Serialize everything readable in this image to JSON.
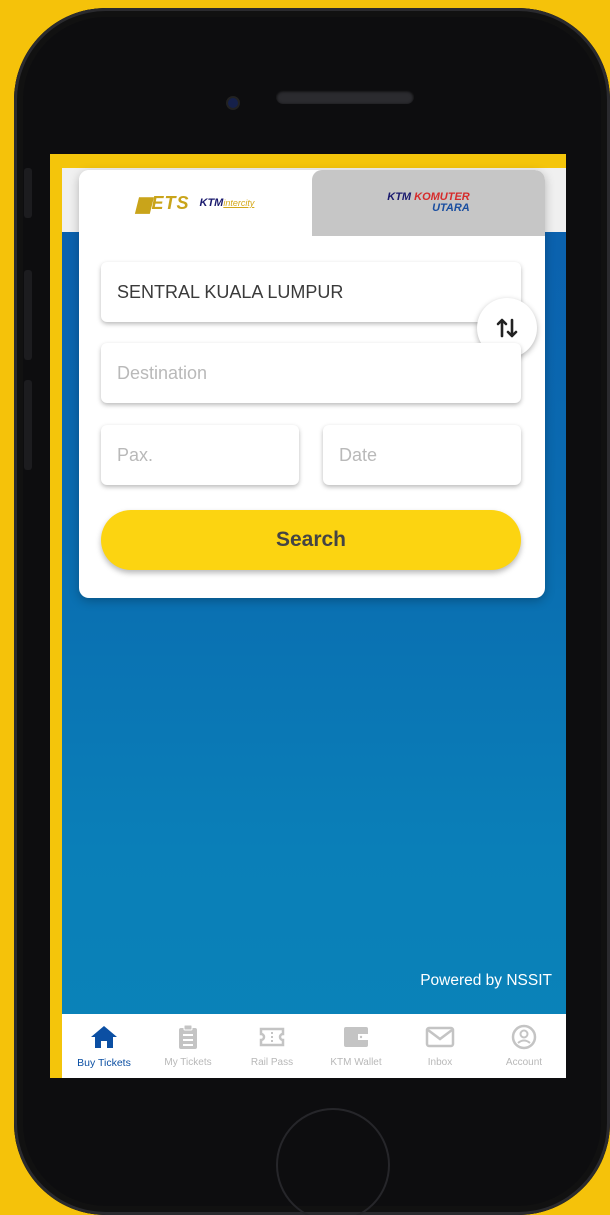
{
  "tabs": [
    {
      "ets_logo": "ETS",
      "ktm_logo": "KTM",
      "ktm_sub": "intercity",
      "active": true
    },
    {
      "komuter_line1a": "KTM ",
      "komuter_line1b": "KOMUTER",
      "komuter_line2": "UTARA",
      "active": false
    }
  ],
  "form": {
    "origin_value": "SENTRAL KUALA LUMPUR",
    "destination_placeholder": "Destination",
    "pax_placeholder": "Pax.",
    "date_placeholder": "Date",
    "search_label": "Search"
  },
  "footer": {
    "powered_by": "Powered by NSSIT"
  },
  "nav": [
    {
      "label": "Buy Tickets",
      "icon": "home-icon",
      "active": true
    },
    {
      "label": "My Tickets",
      "icon": "clipboard-icon",
      "active": false
    },
    {
      "label": "Rail Pass",
      "icon": "ticket-icon",
      "active": false
    },
    {
      "label": "KTM Wallet",
      "icon": "wallet-icon",
      "active": false
    },
    {
      "label": "Inbox",
      "icon": "mail-icon",
      "active": false
    },
    {
      "label": "Account",
      "icon": "account-icon",
      "active": false
    }
  ],
  "colors": {
    "background": "#f5c20a",
    "screen_gradient_top": "#0b5fae",
    "accent_yellow": "#fcd411",
    "nav_active": "#0b4fa3"
  }
}
